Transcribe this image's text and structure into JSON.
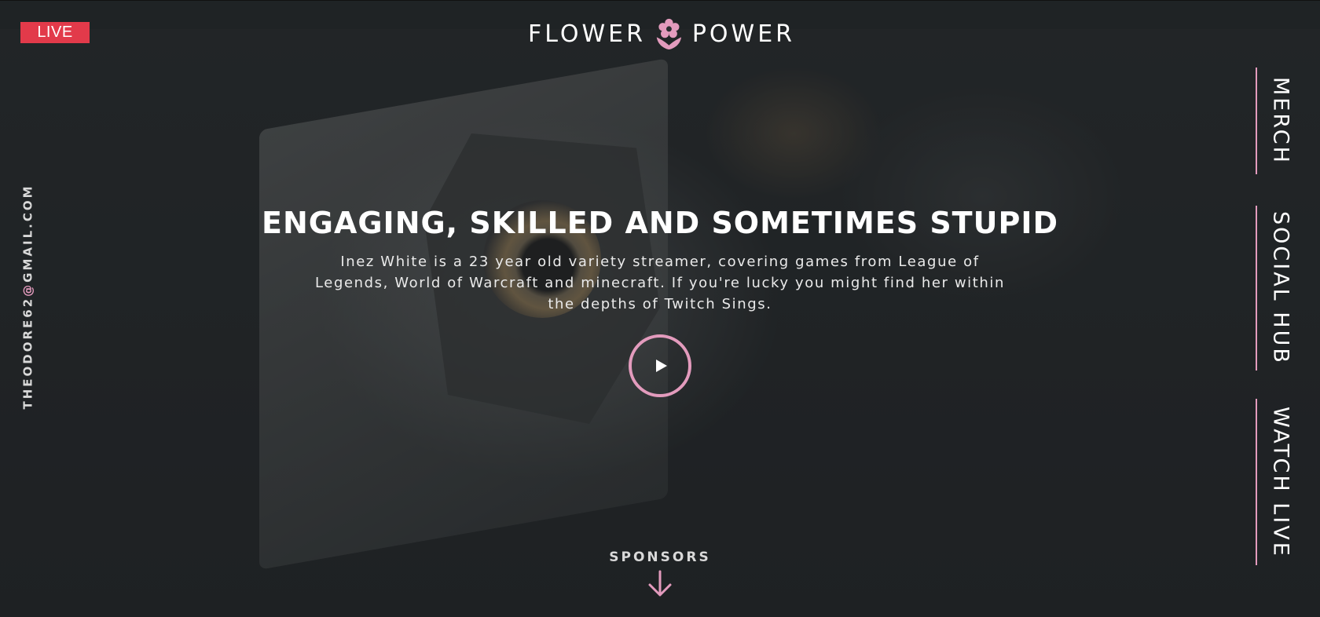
{
  "live_badge": "LIVE",
  "logo": {
    "word_left": "FLOWER",
    "word_right": "POWER",
    "icon": "flower-icon"
  },
  "contact": {
    "email_user": "THEODORE62",
    "email_at": "@",
    "email_domain": "GMAIL.COM"
  },
  "nav": {
    "items": [
      {
        "label": "MERCH"
      },
      {
        "label": "SOCIAL HUB"
      },
      {
        "label": "WATCH LIVE"
      }
    ]
  },
  "hero": {
    "title": "ENGAGING, SKILLED AND SOMETIMES STUPID",
    "text": "Inez White is a 23 year old variety streamer, covering games from League of Legends, World of Warcraft and minecraft. If you're lucky you might find her within the depths of Twitch Sings.",
    "play_icon": "play-icon"
  },
  "sponsors": {
    "label": "SPONSORS",
    "icon": "arrow-down-icon"
  },
  "colors": {
    "accent": "#e39bbd",
    "live": "#e23a4a",
    "background": "#232729"
  }
}
